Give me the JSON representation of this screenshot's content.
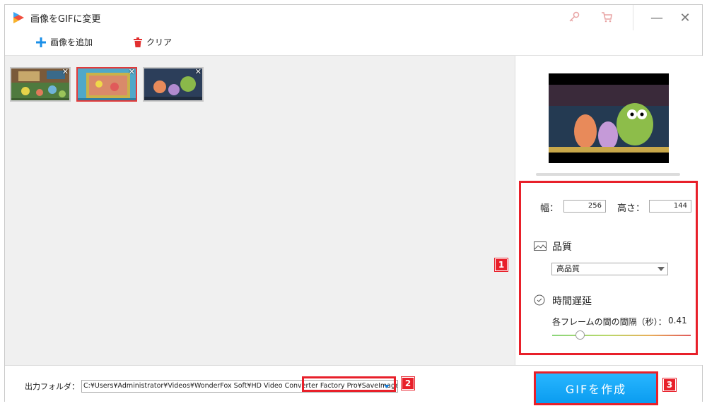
{
  "window": {
    "title": "画像をGIFに変更",
    "minimize_label": "—",
    "close_label": "✕"
  },
  "toolbar": {
    "add_image_label": "画像を追加",
    "clear_label": "クリア"
  },
  "thumbnails": [
    {
      "selected": false
    },
    {
      "selected": true
    },
    {
      "selected": false
    }
  ],
  "settings": {
    "width_label": "幅：",
    "width_value": "256",
    "height_label": "高さ：",
    "height_value": "144",
    "quality_title": "品質",
    "quality_selected": "高品質",
    "delay_title": "時間遅延",
    "delay_caption": "各フレームの間の間隔（秒）：",
    "delay_value": "0.41",
    "delay_fraction": 0.2
  },
  "output": {
    "folder_label": "出力フォルダ：",
    "folder_path": "C:¥Users¥Administrator¥Videos¥WonderFox Soft¥HD Video Converter Factory Pro¥SaveImage¥"
  },
  "create_button_label": "GIFを作成",
  "badges": [
    "1",
    "2",
    "3"
  ],
  "colors": {
    "accent": "#0a9cf0",
    "highlight": "#e8202a"
  }
}
